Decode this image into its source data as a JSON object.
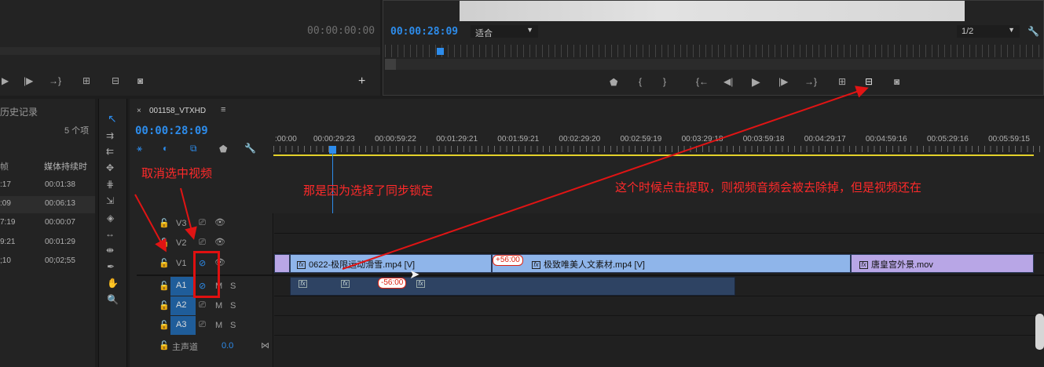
{
  "source_monitor": {
    "timecode": "00:00:00:00"
  },
  "program_monitor": {
    "timecode": "00:00:28:09",
    "fit_label": "适合",
    "resolution": "1/2"
  },
  "project_panel": {
    "tab_label": "历史记录",
    "item_count": "5 个项",
    "col_name": "帧",
    "col_duration": "媒体持续时",
    "rows": [
      {
        "start": ":17",
        "duration": "00:01:38"
      },
      {
        "start": ":09",
        "duration": "00:06:13"
      },
      {
        "start": "7:19",
        "duration": "00:00:07"
      },
      {
        "start": "9:21",
        "duration": "00:01:29"
      },
      {
        "start": ";10",
        "duration": "00;02;55"
      }
    ]
  },
  "timeline": {
    "sequence_name": "001158_VTXHD",
    "timecode": "00:00:28:09",
    "ruler_labels": [
      ":00:00",
      "00:00:29:23",
      "00:00:59:22",
      "00:01:29:21",
      "00:01:59:21",
      "00:02:29:20",
      "00:02:59:19",
      "00:03:29:18",
      "00:03:59:18",
      "00:04:29:17",
      "00:04:59:16",
      "00:05:29:16",
      "00:05:59:15"
    ],
    "tracks": {
      "v3": "V3",
      "v2": "V2",
      "v1": "V1",
      "a1": "A1",
      "a2": "A2",
      "a3": "A3",
      "master": "主声道",
      "master_value": "0.0",
      "m": "M",
      "s": "S"
    },
    "clips": {
      "clip1": "0622-极限运动滑雪.mp4 [V]",
      "clip2": "极致唯美人文素材.mp4 [V]",
      "clip3": "唐皇宫外景.mov",
      "badge_video": "+56:00",
      "badge_audio": "-56:00",
      "fx": "fx"
    }
  },
  "annotations": {
    "deselect_video": "取消选中视频",
    "sync_lock": "那是因为选择了同步锁定",
    "extract_note": "这个时候点击提取，则视频音频会被去除掉，但是视频还在"
  },
  "colors": {
    "accent": "#2d8ceb",
    "annotation": "#ff2a2a",
    "clip_video": "#8fb5ea",
    "clip_purple": "#b8a6e6",
    "clip_audio": "#2e4363"
  }
}
